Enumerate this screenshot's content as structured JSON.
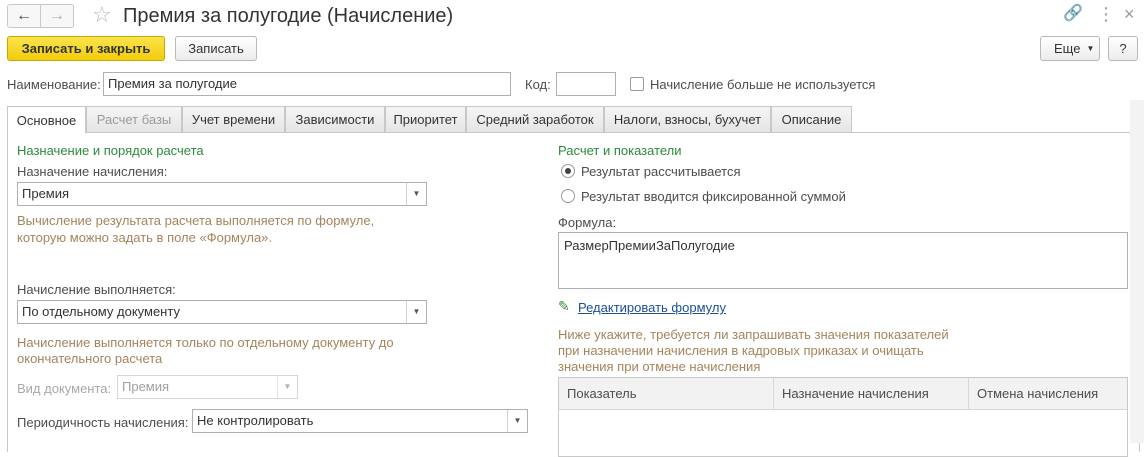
{
  "window": {
    "title": "Премия за полугодие (Начисление)"
  },
  "icons": {
    "back": "arrow-left-icon",
    "forward": "arrow-right-icon",
    "favorite": "star-icon",
    "link": "link-icon",
    "more": "more-vertical-icon",
    "close": "close-icon",
    "edit": "pencil-icon"
  },
  "toolbar": {
    "save_close_label": "Записать и закрыть",
    "save_label": "Записать",
    "more_label": "Еще",
    "help_label": "?"
  },
  "header_fields": {
    "name_label": "Наименование:",
    "name_value": "Премия за полугодие",
    "code_label": "Код:",
    "code_value": "",
    "unused_label": "Начисление больше не используется",
    "unused_checked": false
  },
  "tabs": [
    {
      "label": "Основное",
      "active": true
    },
    {
      "label": "Расчет базы",
      "active": false
    },
    {
      "label": "Учет времени",
      "active": false
    },
    {
      "label": "Зависимости",
      "active": false
    },
    {
      "label": "Приоритет",
      "active": false
    },
    {
      "label": "Средний заработок",
      "active": false
    },
    {
      "label": "Налоги, взносы, бухучет",
      "active": false
    },
    {
      "label": "Описание",
      "active": false
    }
  ],
  "left": {
    "section_title": "Назначение и порядок расчета",
    "purpose_label": "Назначение начисления:",
    "purpose_value": "Премия",
    "purpose_hint_1": "Вычисление результата расчета выполняется по формуле,",
    "purpose_hint_2": "которую можно задать в поле «Формула».",
    "exec_label": "Начисление выполняется:",
    "exec_value": "По отдельному документу",
    "exec_hint_1": "Начисление выполняется только по отдельному документу до",
    "exec_hint_2": "окончательного расчета",
    "doc_type_label": "Вид документа:",
    "doc_type_value": "Премия",
    "period_label": "Периодичность начисления:",
    "period_value": "Не контролировать"
  },
  "right": {
    "section_title": "Расчет и показатели",
    "radio_calc_label": "Результат рассчитывается",
    "radio_fixed_label": "Результат вводится фиксированной суммой",
    "selected_radio": "calc",
    "formula_label": "Формула:",
    "formula_value": "РазмерПремииЗаПолугодие",
    "edit_formula_label": "Редактировать формулу",
    "indicators_hint_1": "Ниже укажите, требуется ли запрашивать значения показателей",
    "indicators_hint_2": "при назначении начисления в кадровых приказах и очищать",
    "indicators_hint_3": "значения при отмене начисления",
    "grid_columns": [
      "Показатель",
      "Назначение начисления",
      "Отмена начисления"
    ]
  },
  "colors": {
    "accent_button": "#f2cd0b",
    "section_title": "#2c8a3c",
    "hint_text": "#a4845c",
    "link": "#1a4f9c"
  }
}
